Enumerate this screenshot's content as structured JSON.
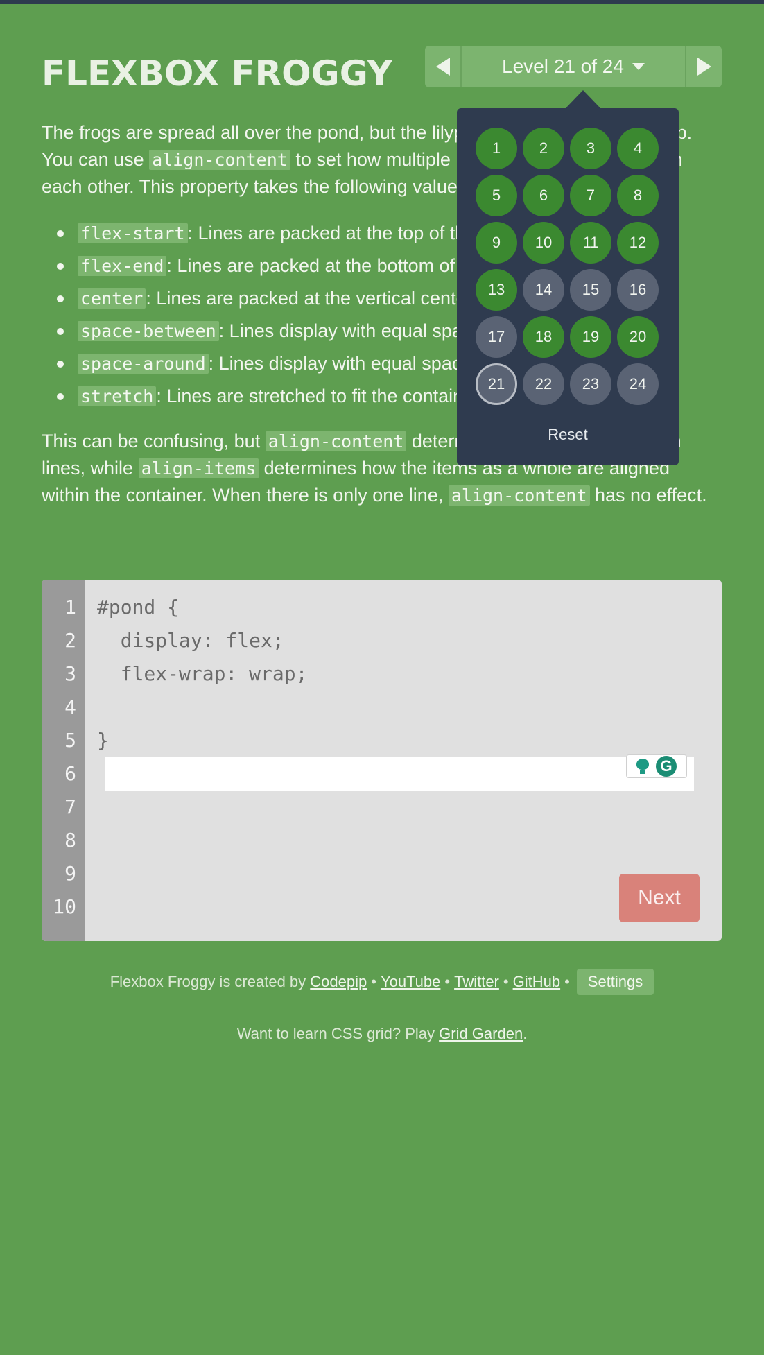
{
  "header": {
    "title": "FLEXBOX FROGGY",
    "level_label": "Level 21 of 24"
  },
  "instructions": {
    "intro": "The frogs are spread all over the pond, but the lilypads are bunched at the top. You can use align-content to set how multiple lines are spaced apart from each other. This property takes the following values:",
    "intro_parts": [
      "The frogs are spread all over the pond, but the lilypads are bunched at the top. You can use ",
      "align-content",
      " to set how multiple lines are spaced apart from each other. This property takes the following values:"
    ],
    "options": [
      {
        "code": "flex-start",
        "text": ": Lines are packed at the top of the container."
      },
      {
        "code": "flex-end",
        "text": ": Lines are packed at the bottom of the container."
      },
      {
        "code": "center",
        "text": ": Lines are packed at the vertical center of the container."
      },
      {
        "code": "space-between",
        "text": ": Lines display with equal spacing between them."
      },
      {
        "code": "space-around",
        "text": ": Lines display with equal spacing around them."
      },
      {
        "code": "stretch",
        "text": ": Lines are stretched to fit the container."
      }
    ],
    "note_parts": [
      "This can be confusing, but ",
      "align-content",
      " determines the spacing between lines, while ",
      "align-items",
      " determines how the items as a whole are aligned within the container. When there is only one line, ",
      "align-content",
      " has no effect."
    ]
  },
  "levels": {
    "items": [
      {
        "n": "1",
        "state": "solved"
      },
      {
        "n": "2",
        "state": "solved"
      },
      {
        "n": "3",
        "state": "solved"
      },
      {
        "n": "4",
        "state": "solved"
      },
      {
        "n": "5",
        "state": "solved"
      },
      {
        "n": "6",
        "state": "solved"
      },
      {
        "n": "7",
        "state": "solved"
      },
      {
        "n": "8",
        "state": "solved"
      },
      {
        "n": "9",
        "state": "solved"
      },
      {
        "n": "10",
        "state": "solved"
      },
      {
        "n": "11",
        "state": "solved"
      },
      {
        "n": "12",
        "state": "solved"
      },
      {
        "n": "13",
        "state": "solved"
      },
      {
        "n": "14",
        "state": "unsolved"
      },
      {
        "n": "15",
        "state": "unsolved"
      },
      {
        "n": "16",
        "state": "unsolved"
      },
      {
        "n": "17",
        "state": "unsolved"
      },
      {
        "n": "18",
        "state": "solved"
      },
      {
        "n": "19",
        "state": "solved"
      },
      {
        "n": "20",
        "state": "solved"
      },
      {
        "n": "21",
        "state": "current"
      },
      {
        "n": "22",
        "state": "unsolved"
      },
      {
        "n": "23",
        "state": "unsolved"
      },
      {
        "n": "24",
        "state": "unsolved"
      }
    ],
    "reset_label": "Reset"
  },
  "editor": {
    "line_numbers": [
      "1",
      "2",
      "3",
      "4",
      "5",
      "6",
      "7",
      "8",
      "9",
      "10"
    ],
    "line1": "#pond {",
    "line2": "  display: flex;",
    "line3": "  flex-wrap: wrap;",
    "input_value": "",
    "line5": "}",
    "next_label": "Next"
  },
  "footer": {
    "credit_prefix": "Flexbox Froggy is created by ",
    "links": [
      "Codepip",
      "YouTube",
      "Twitter",
      "GitHub"
    ],
    "settings_label": "Settings",
    "promo_prefix": "Want to learn CSS grid? Play ",
    "promo_link": "Grid Garden",
    "promo_suffix": "."
  },
  "colors": {
    "background": "#5e9e50",
    "dropdown": "#2f3b4f",
    "solved": "#3b8930",
    "unsolved": "#5a6374",
    "next_button": "#d9827a"
  }
}
